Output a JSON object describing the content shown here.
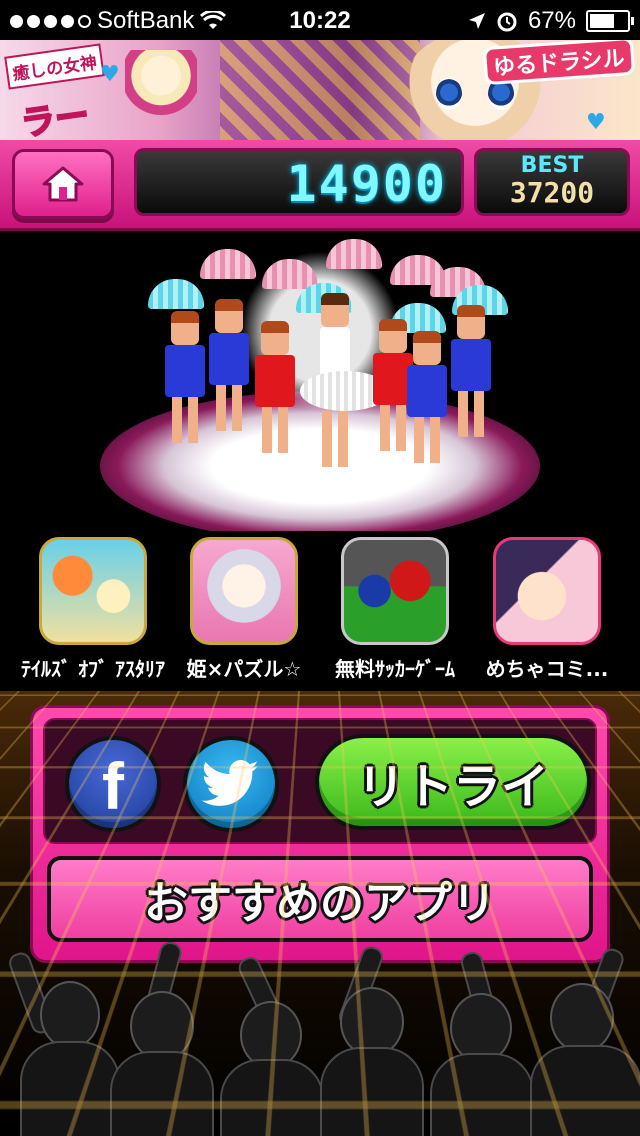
{
  "status_bar": {
    "carrier": "SoftBank",
    "time": "10:22",
    "battery_percent": "67%",
    "battery_level": 0.67,
    "signal_bars": 4
  },
  "ad_banner": {
    "title_small": "癒しの女神",
    "title_large": "ラーン",
    "logo": "ゆるドラシル"
  },
  "header": {
    "score": "14900",
    "best_label": "BEST",
    "best_value": "37200"
  },
  "apps": [
    {
      "label": "ﾃｲﾙｽﾞ ｵﾌﾞ ｱｽﾀﾘｱ",
      "icon": "tales-app-icon"
    },
    {
      "label": "姫×パズル☆",
      "icon": "hime-puzzle-app-icon"
    },
    {
      "label": "無料ｻｯｶｰｹﾞｰﾑ",
      "icon": "soccer-app-icon"
    },
    {
      "label": "めちゃコミ...",
      "icon": "mechacomi-app-icon"
    }
  ],
  "actions": {
    "facebook_label": "f",
    "retry_label": "リトライ",
    "recommend_label": "おすすめのアプリ"
  },
  "colors": {
    "accent_pink": "#e0158a",
    "retry_green": "#3ab81a",
    "score_cyan": "#7ff8ff",
    "facebook_blue": "#1a3a96",
    "twitter_blue": "#0a78c0"
  }
}
